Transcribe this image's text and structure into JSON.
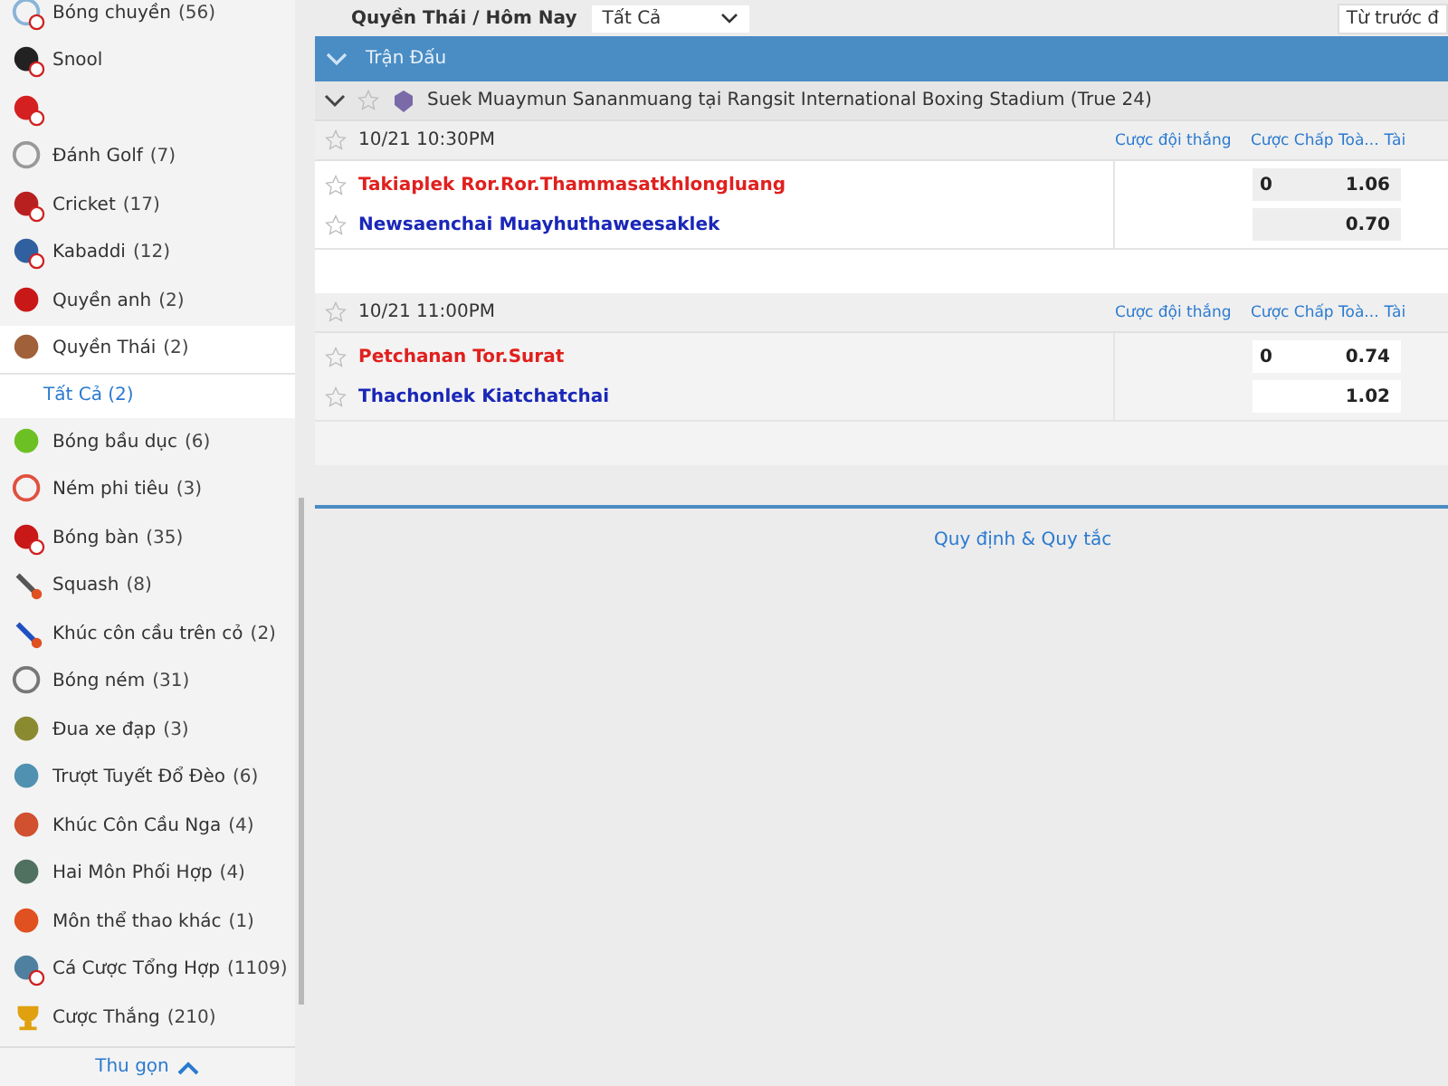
{
  "sidebar": {
    "items": [
      {
        "label": "Bóng chuyền",
        "count": "(56)",
        "live": true,
        "selected": false
      },
      {
        "label": "Snool",
        "live": true,
        "selected": false
      },
      {
        "live": true,
        "selected": false
      },
      {
        "label": "Đánh Golf",
        "count": "(7)",
        "live": false,
        "selected": false
      },
      {
        "label": "Cricket",
        "count": "(17)",
        "live": true,
        "selected": false
      },
      {
        "label": "Kabaddi",
        "count": "(12)",
        "live": true,
        "selected": false
      },
      {
        "label": "Quyền anh",
        "count": "(2)",
        "live": false,
        "selected": false
      },
      {
        "label": "Quyền Thái",
        "count": "(2)",
        "live": false,
        "selected": true,
        "children": [
          {
            "label": "Tất Cả",
            "count": "(2)"
          }
        ]
      },
      {
        "label": "Bóng bầu dục",
        "count": "(6)",
        "live": false,
        "selected": false
      },
      {
        "label": "Ném phi tiêu",
        "count": "(3)",
        "live": false,
        "selected": false
      },
      {
        "label": "Bóng bàn",
        "count": "(35)",
        "live": true,
        "selected": false
      },
      {
        "label": "Squash",
        "count": "(8)",
        "live": false,
        "selected": false
      },
      {
        "label": "Khúc côn cầu trên cỏ",
        "count": "(2)",
        "live": false,
        "selected": false
      },
      {
        "label": "Bóng ném",
        "count": "(31)",
        "live": false,
        "selected": false
      },
      {
        "label": "Đua xe đạp",
        "count": "(3)",
        "live": false,
        "selected": false
      },
      {
        "label": "Trượt Tuyết Đổ Đèo",
        "count": "(6)",
        "live": false,
        "selected": false
      },
      {
        "label": "Khúc Côn Cầu Nga",
        "count": "(4)",
        "live": false,
        "selected": false
      },
      {
        "label": "Hai Môn Phối Hợp",
        "count": "(4)",
        "live": false,
        "selected": false
      },
      {
        "label": "Môn thể thao khác",
        "count": "(1)",
        "live": false,
        "selected": false
      },
      {
        "label": "Cá Cược Tổng Hợp",
        "count": "(1109)",
        "live": true,
        "selected": false
      },
      {
        "label": "Cược Thắng",
        "count": "(210)",
        "live": false,
        "selected": false
      }
    ],
    "collapse": "Thu gọn"
  },
  "toolbar": {
    "breadcrumb": "Quyền Thái / Hôm Nay",
    "filter": "Tất Cả",
    "date_field": "Từ trước đ"
  },
  "section": {
    "title": "Trận Đấu",
    "expanded": true
  },
  "league": {
    "name": "Suek Muaymun Sananmuang tại Rangsit International Boxing Stadium (True 24)",
    "expanded": true,
    "favorite": false
  },
  "matches": [
    {
      "time": "10/21 10:30PM",
      "columns": [
        "Cược đội thắng",
        "Cược Chấp Toà...",
        "Tài"
      ],
      "teams": [
        {
          "name": "Takiaplek Ror.Ror.Thammasatkhlongluang",
          "color": "#e0201e",
          "handicap": "0",
          "odds": "1.06"
        },
        {
          "name": "Newsaenchai Muayhuthaweesaklek",
          "color": "#1a27b8",
          "odds": "0.70"
        }
      ]
    },
    {
      "time": "10/21 11:00PM",
      "columns": [
        "Cược đội thắng",
        "Cược Chấp Toà...",
        "Tài"
      ],
      "teams": [
        {
          "name": "Petchanan Tor.Surat",
          "color": "#e0201e",
          "handicap": "0",
          "odds": "0.74"
        },
        {
          "name": "Thachonlek Kiatchatchai",
          "color": "#1a27b8",
          "odds": "1.02"
        }
      ]
    }
  ],
  "footer_link": "Quy định & Quy tắc"
}
